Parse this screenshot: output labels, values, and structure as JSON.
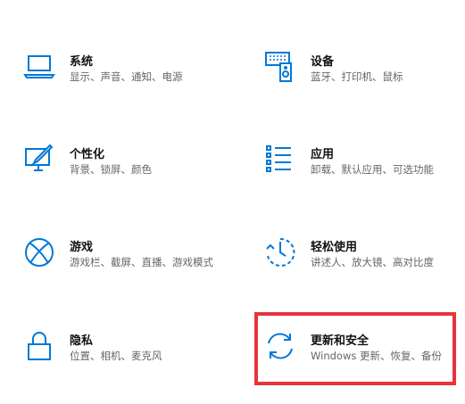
{
  "accent_color": "#0078d7",
  "highlight_color": "#e8333c",
  "tiles": [
    {
      "title": "系统",
      "desc": "显示、声音、通知、电源",
      "icon": "laptop-icon"
    },
    {
      "title": "设备",
      "desc": "蓝牙、打印机、鼠标",
      "icon": "devices-icon"
    },
    {
      "title": "个性化",
      "desc": "背景、锁屏、颜色",
      "icon": "personalization-icon"
    },
    {
      "title": "应用",
      "desc": "卸载、默认应用、可选功能",
      "icon": "apps-list-icon"
    },
    {
      "title": "游戏",
      "desc": "游戏栏、截屏、直播、游戏模式",
      "icon": "xbox-icon"
    },
    {
      "title": "轻松使用",
      "desc": "讲述人、放大镜、高对比度",
      "icon": "ease-of-access-icon"
    },
    {
      "title": "隐私",
      "desc": "位置、相机、麦克风",
      "icon": "lock-icon"
    },
    {
      "title": "更新和安全",
      "desc": "Windows 更新、恢复、备份",
      "icon": "sync-icon"
    }
  ]
}
